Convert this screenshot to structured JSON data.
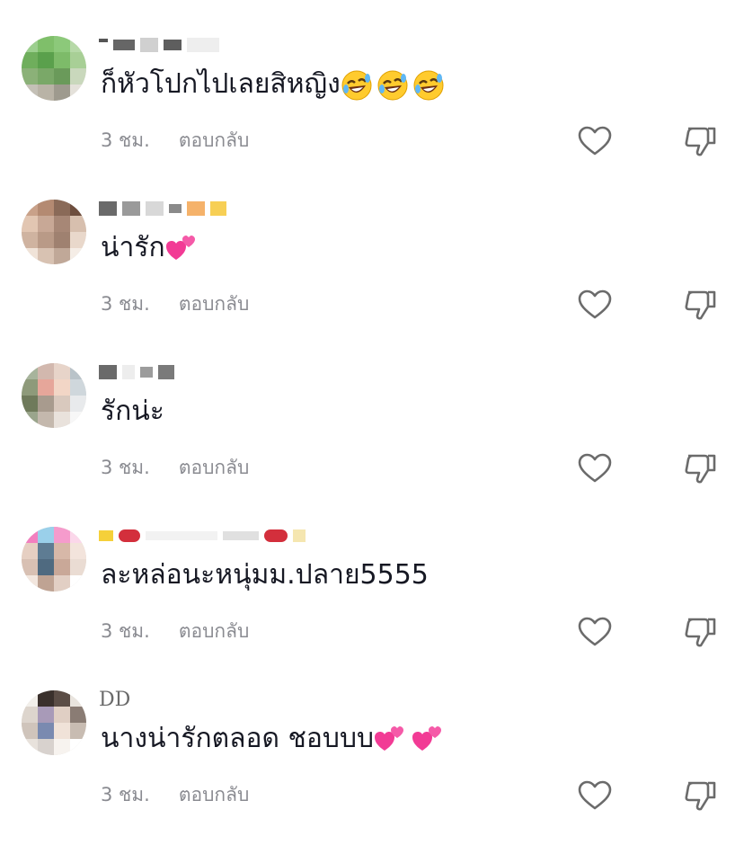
{
  "comments": [
    {
      "username": "",
      "text": "ก็หัวโปกไปเลยสิหญิง",
      "emoji": [
        "rolling-laughing-emoji",
        "rolling-laughing-emoji",
        "rolling-laughing-emoji"
      ],
      "time": "3 ชม.",
      "reply": "ตอบกลับ"
    },
    {
      "username": "",
      "text": "น่ารัก",
      "emoji": [
        "two-hearts-emoji"
      ],
      "time": "3 ชม.",
      "reply": "ตอบกลับ"
    },
    {
      "username": "",
      "text": "รักน่ะ",
      "emoji": [],
      "time": "3 ชม.",
      "reply": "ตอบกลับ"
    },
    {
      "username": "",
      "text": "ละหล่อนะหนุ่มม.ปลาย5555",
      "emoji": [],
      "time": "3 ชม.",
      "reply": "ตอบกลับ"
    },
    {
      "username": "DD",
      "text": "นางน่ารักตลอด ชอบบบ",
      "emoji": [
        "two-hearts-emoji",
        "two-hearts-emoji"
      ],
      "time": "3 ชม.",
      "reply": "ตอบกลับ"
    }
  ],
  "colors": {
    "text": "#161823",
    "meta": "#8a8b91",
    "icon": "#6b6b6b"
  }
}
